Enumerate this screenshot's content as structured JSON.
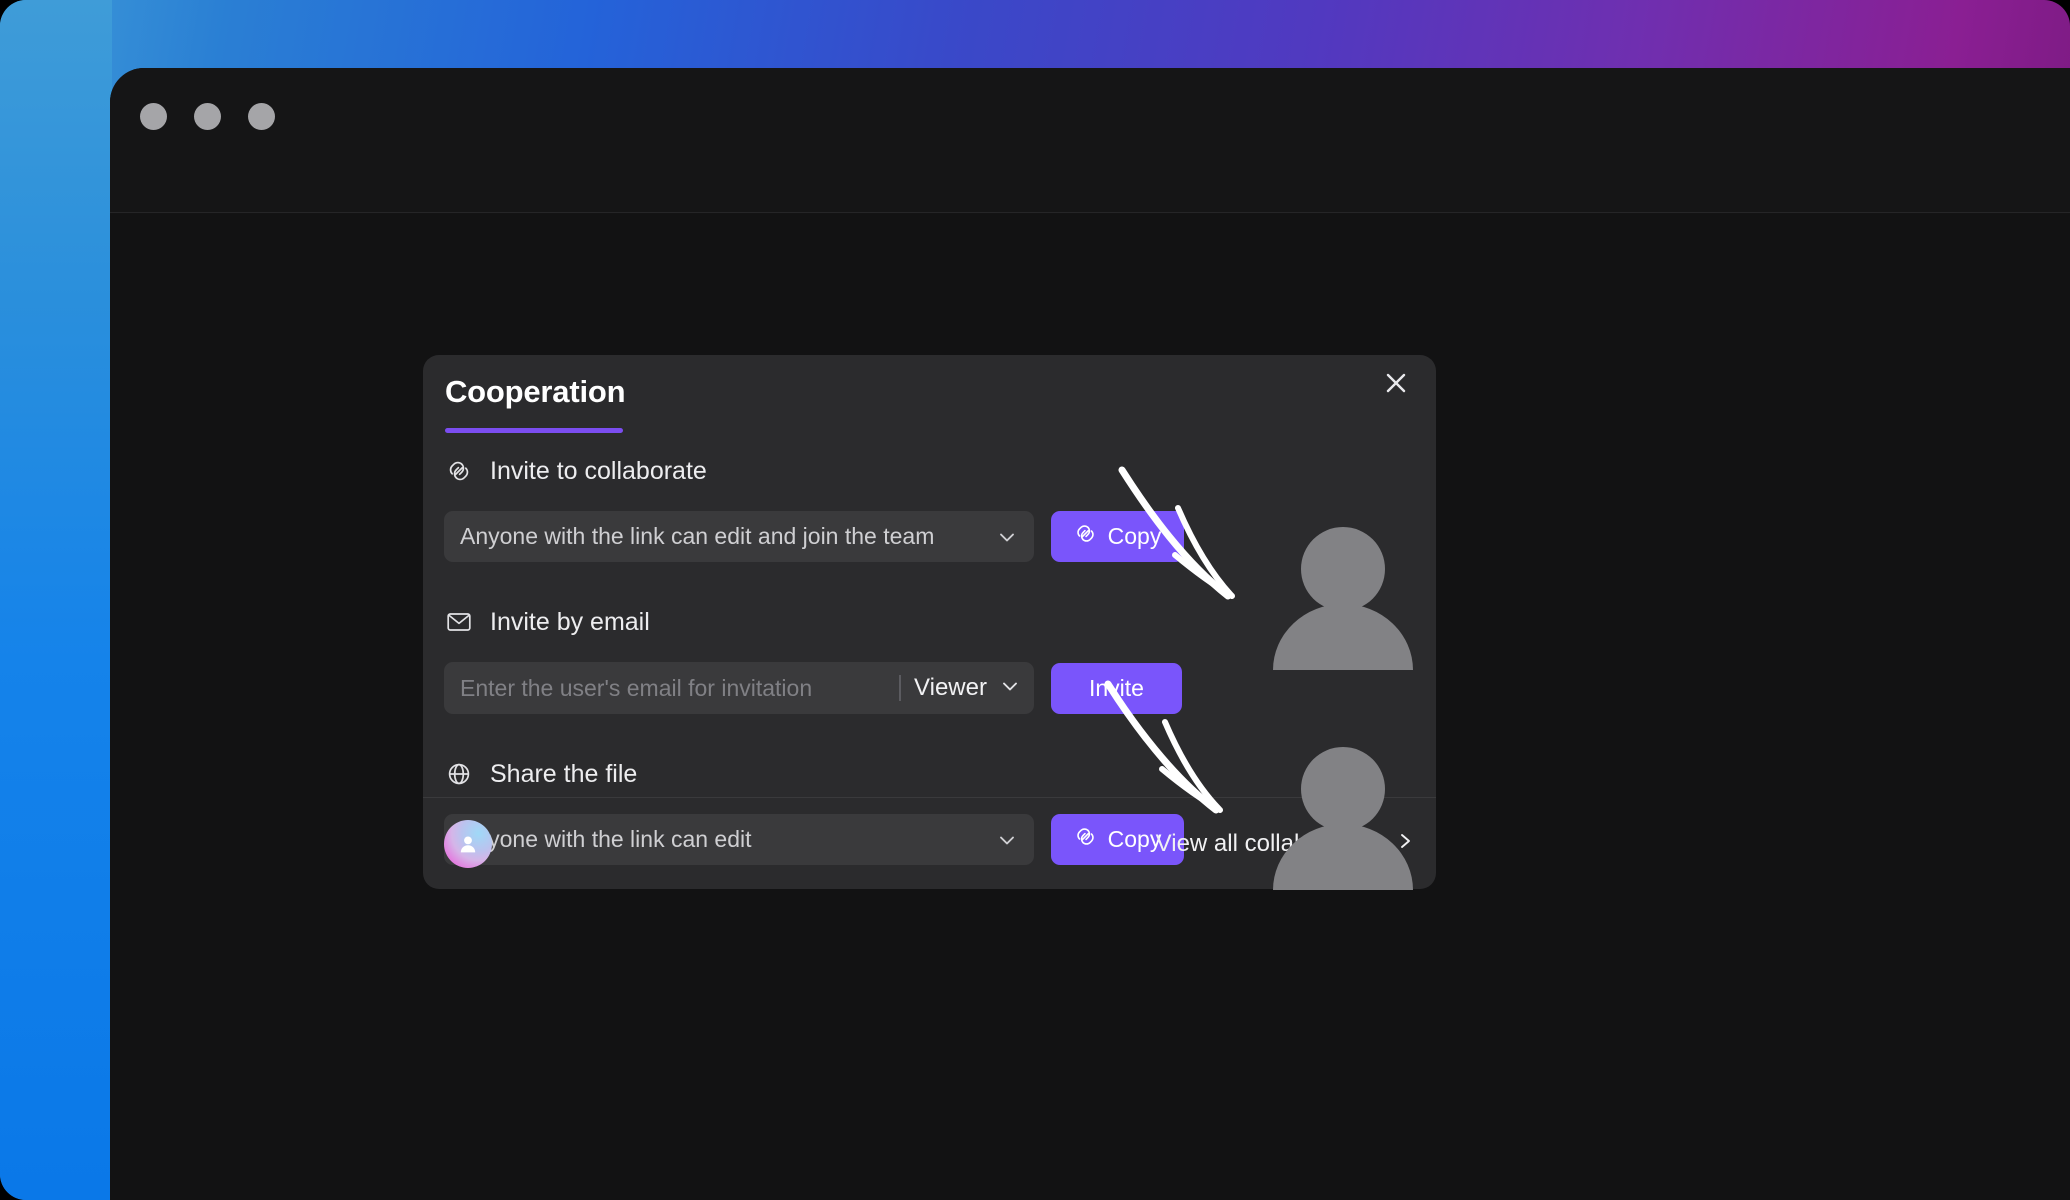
{
  "window": {
    "controls": [
      "close-dot",
      "minimize-dot",
      "maximize-dot"
    ]
  },
  "dialog": {
    "title": "Cooperation",
    "close_label": "×",
    "accent_color": "#7a55fb",
    "underline_color": "#7b4df0",
    "sections": [
      {
        "icon": "link-icon",
        "label": "Invite to collaborate",
        "select_value": "Anyone with the link can edit and join the team",
        "button_label": "Copy",
        "button_icon": "link-icon"
      },
      {
        "icon": "mail-icon",
        "label": "Invite by email",
        "input_value": "",
        "input_placeholder": "Enter the user's email for invitation",
        "role_value": "Viewer",
        "button_label": "Invite"
      },
      {
        "icon": "globe-icon",
        "label": "Share the file",
        "select_value": "Anyone with the link can edit",
        "button_label": "Copy",
        "button_icon": "link-icon"
      }
    ],
    "footer": {
      "avatar_icon": "user-avatar",
      "view_all_label": "View all collaborators",
      "chevron_icon": "chevron-right-icon"
    }
  },
  "annotations": {
    "arrows": [
      "arrow-to-first-person",
      "arrow-to-second-person"
    ],
    "people": [
      "person-silhouette-1",
      "person-silhouette-2"
    ]
  }
}
